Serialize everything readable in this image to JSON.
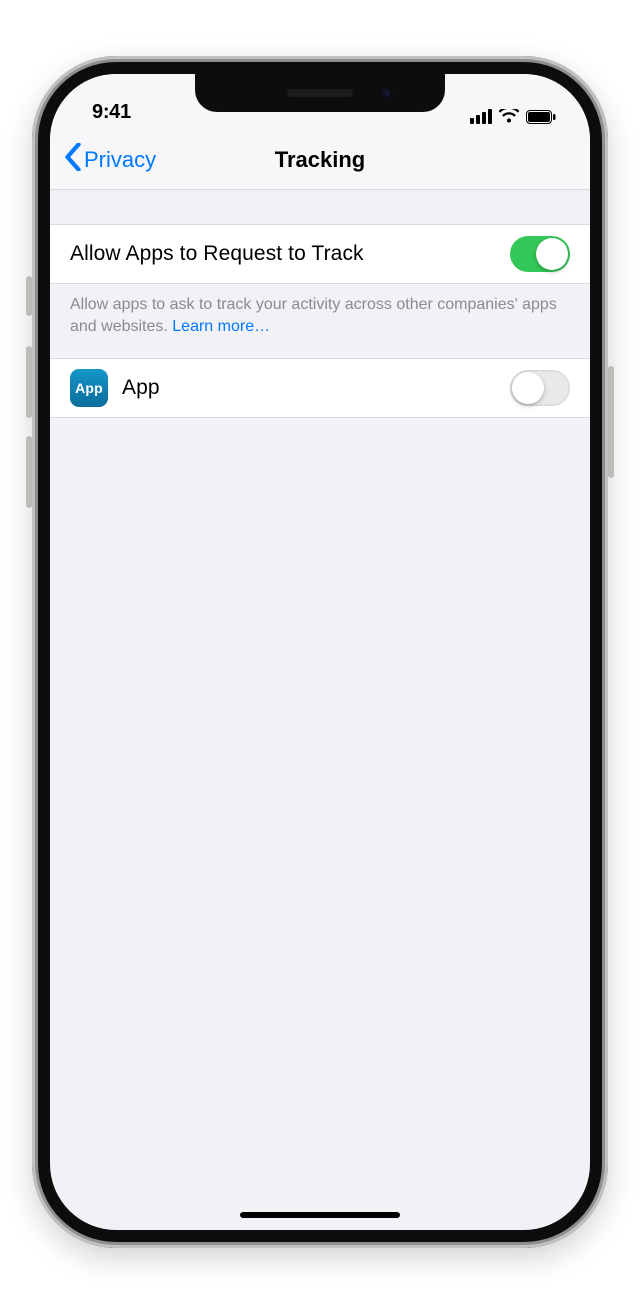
{
  "status": {
    "time": "9:41"
  },
  "nav": {
    "back_label": "Privacy",
    "title": "Tracking"
  },
  "settings": {
    "allow_apps": {
      "label": "Allow Apps to Request to Track",
      "on": true,
      "footer": "Allow apps to ask to track your activity across other companies' apps and websites. ",
      "learn_more": "Learn more…"
    },
    "apps": [
      {
        "name": "App",
        "icon_text": "App",
        "on": false
      }
    ]
  }
}
